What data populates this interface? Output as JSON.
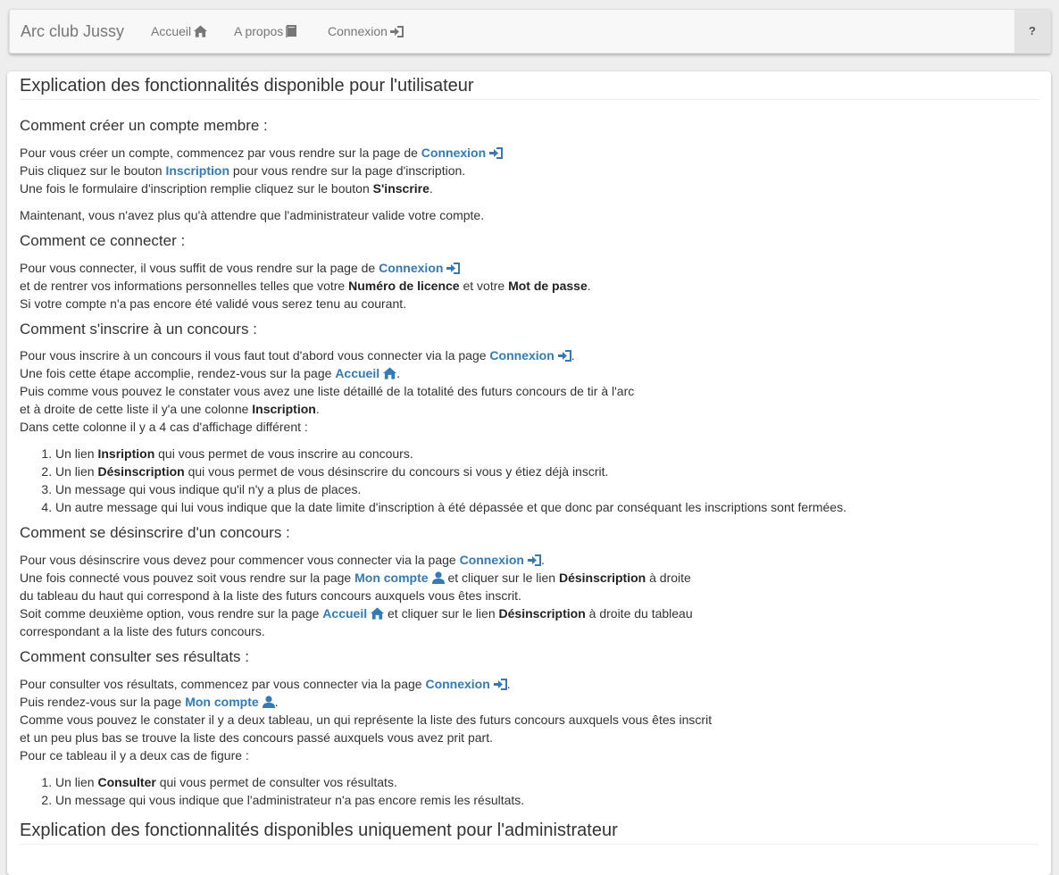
{
  "nav": {
    "brand": "Arc club Jussy",
    "links": [
      {
        "label": "Accueil",
        "icon": "home-icon"
      },
      {
        "label": "A propos",
        "icon": "book-icon"
      },
      {
        "label": "Connexion",
        "icon": "login-icon"
      }
    ],
    "help_label": "?"
  },
  "colors": {
    "link": "#337ab7",
    "text": "#333333",
    "nav_bg": "#f8f8f8",
    "page_bg": "#eeeeee"
  },
  "user_title": "Explication des fonctionnalités disponible pour l'utilisateur",
  "admin_title": "Explication des fonctionnalités disponibles uniquement pour l'administrateur",
  "s1": {
    "title": "Comment créer un compte membre :",
    "l1a": "Pour vous créer un compte, commencez par vous rendre sur la page de ",
    "l1link": "Connexion",
    "l2a": "Puis cliquez sur le bouton ",
    "l2link": "Inscription",
    "l2b": " pour vous rendre sur la page d'inscription.",
    "l3a": "Une fois le formulaire d'inscription remplie cliquez sur le bouton ",
    "l3b": "S'inscrire",
    "l3c": ".",
    "l4": "Maintenant, vous n'avez plus qu'à attendre que l'administrateur valide votre compte."
  },
  "s2": {
    "title": "Comment ce connecter :",
    "l1a": "Pour vous connecter, il vous suffit de vous rendre sur la page de ",
    "l1link": "Connexion",
    "l2a": "et de rentrer vos informations personnelles telles que votre ",
    "l2b": "Numéro de licence",
    "l2c": " et votre ",
    "l2d": "Mot de passe",
    "l2e": ".",
    "l3": "Si votre compte n'a pas encore été validé vous serez tenu au courant."
  },
  "s3": {
    "title": "Comment s'inscrire à un concours :",
    "l1a": "Pour vous inscrire à un concours il vous faut tout d'abord vous connecter via la page ",
    "l1link": "Connexion",
    "l1b": ".",
    "l2a": "Une fois cette étape accomplie, rendez-vous sur la page ",
    "l2link": "Accueil",
    "l2b": ".",
    "l3": "Puis comme vous pouvez le constater vous avez une liste détaillé de la totalité des futurs concours de tir à l'arc",
    "l4a": "et à droite de cette liste il y'a une colonne ",
    "l4b": "Inscription",
    "l4c": ".",
    "l5": "Dans cette colonne il y a 4 cas d'affichage différent :",
    "items": [
      {
        "a": "Un lien ",
        "b": "Insription",
        "c": " qui vous permet de vous inscrire au concours."
      },
      {
        "a": "Un lien ",
        "b": "Désinscription",
        "c": " qui vous permet de vous désinscrire du concours si vous y étiez déjà inscrit."
      },
      {
        "a": "Un message qui vous indique qu'il n'y a plus de places.",
        "b": "",
        "c": ""
      },
      {
        "a": "Un autre message qui lui vous indique que la date limite d'inscription à été dépassée et que donc par conséquant les inscriptions sont fermées.",
        "b": "",
        "c": ""
      }
    ]
  },
  "s4": {
    "title": "Comment se désinscrire d'un concours :",
    "l1a": "Pour vous désinscrire vous devez pour commencer vous connecter via la page ",
    "l1link": "Connexion",
    "l1b": ".",
    "l2a": "Une fois connecté vous pouvez soit vous rendre sur la page ",
    "l2link": "Mon compte",
    "l2b": " et cliquer sur le lien ",
    "l2c": "Désinscription",
    "l2d": " à droite",
    "l3": "du tableau du haut qui correspond à la liste des futurs concours auxquels vous êtes inscrit.",
    "l4a": "Soit comme deuxième option, vous rendre sur la page ",
    "l4link": "Accueil",
    "l4b": " et cliquer sur le lien ",
    "l4c": "Désinscription",
    "l4d": " à droite du tableau",
    "l5": "correspondant a la liste des futurs concours."
  },
  "s5": {
    "title": "Comment consulter ses résultats :",
    "l1a": "Pour consulter vos résultats, commencez par vous connecter via la page ",
    "l1link": "Connexion",
    "l1b": ".",
    "l2a": "Puis rendez-vous sur la page ",
    "l2link": "Mon compte",
    "l2b": ".",
    "l3": "Comme vous pouvez le constater il y a deux tableau, un qui représente la liste des futurs concours auxquels vous êtes inscrit",
    "l4": "et un peu plus bas se trouve la liste des concours passé auxquels vous avez prit part.",
    "l5": "Pour ce tableau il y a deux cas de figure :",
    "items": [
      {
        "a": "Un lien ",
        "b": "Consulter",
        "c": " qui vous permet de consulter vos résultats."
      },
      {
        "a": "Un message qui vous indique que l'administrateur n'a pas encore remis les résultats.",
        "b": "",
        "c": ""
      }
    ]
  }
}
